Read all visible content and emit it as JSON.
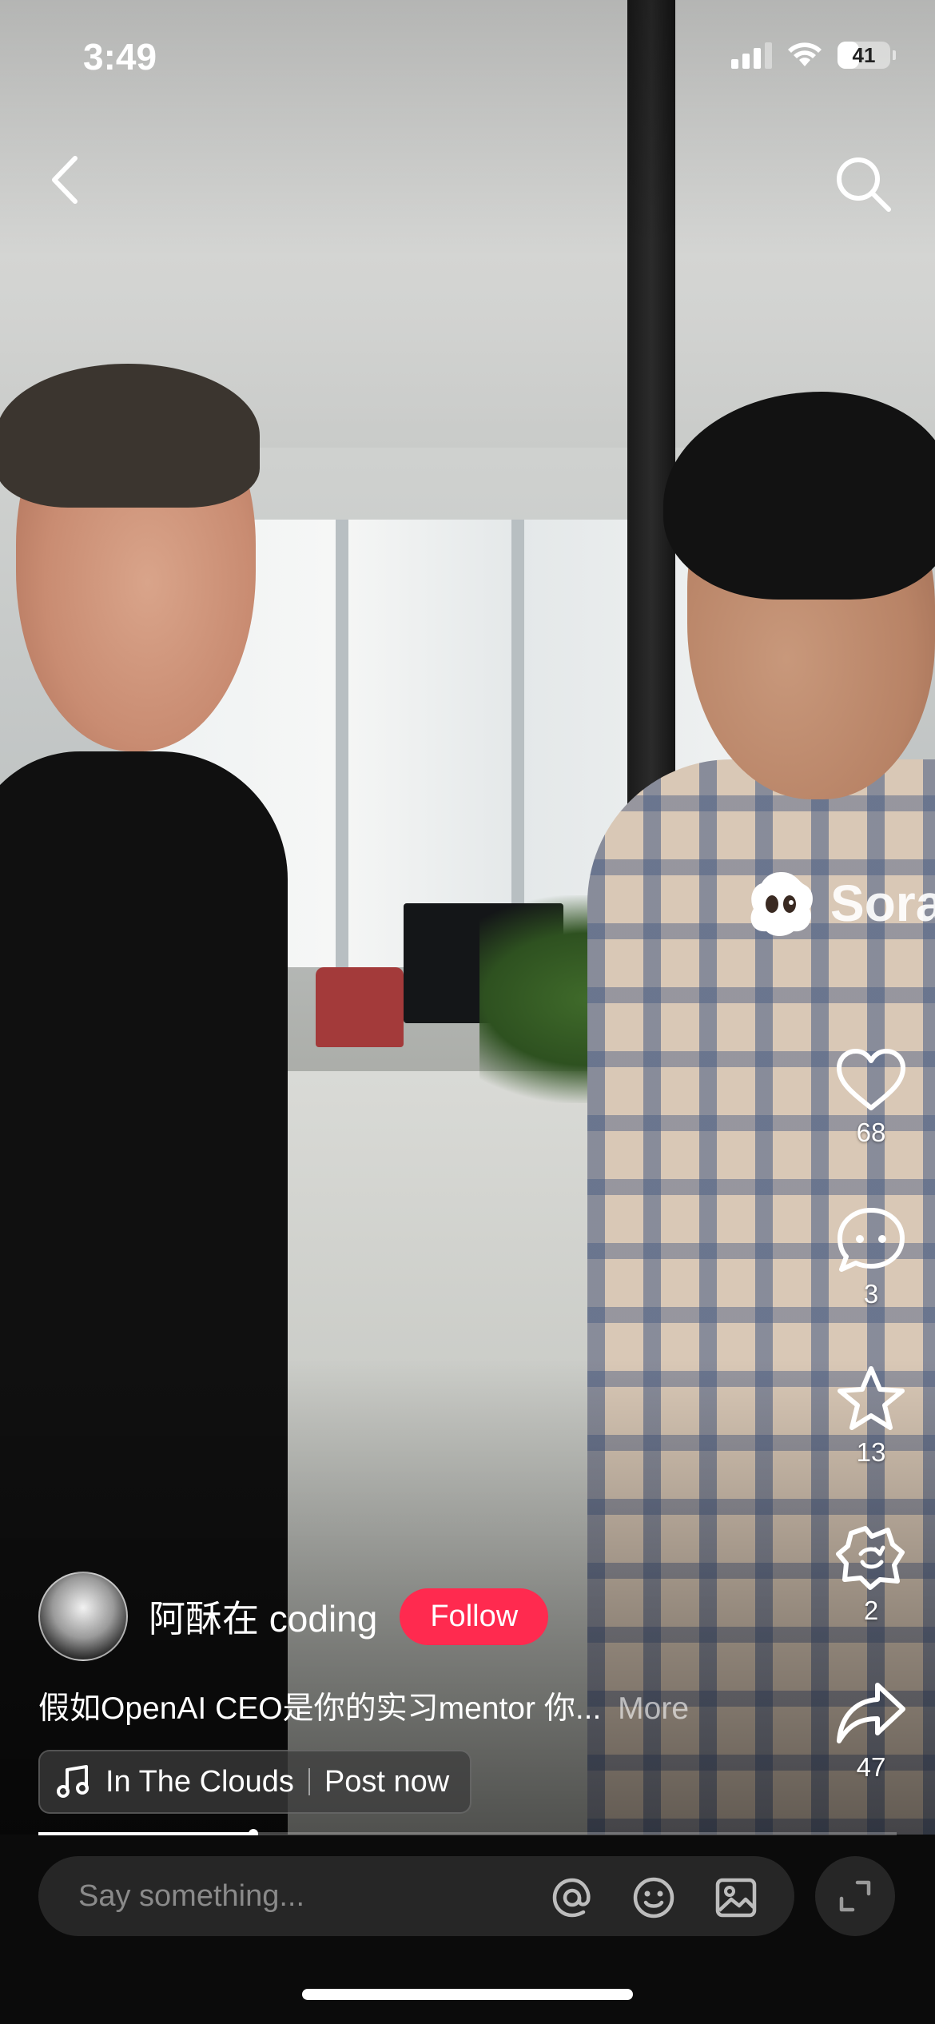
{
  "status_bar": {
    "time": "3:49",
    "battery": "41",
    "battery_level": 0.41
  },
  "nav": {
    "back_icon": "chevron-left-icon",
    "search_icon": "search-icon"
  },
  "watermark": {
    "text": "Sora"
  },
  "actions": {
    "like_count": "68",
    "comment_count": "3",
    "favorite_count": "13",
    "remix_count": "2",
    "share_count": "47"
  },
  "author": {
    "name": "阿酥在 coding",
    "follow_label": "Follow"
  },
  "caption": {
    "text": "假如OpenAI CEO是你的实习mentor 你...",
    "more_label": "More"
  },
  "music": {
    "title": "In The Clouds",
    "post_label": "Post now"
  },
  "playback": {
    "progress": 0.25
  },
  "comment": {
    "placeholder": "Say something..."
  },
  "colors": {
    "follow": "#ff2a4f",
    "bottom_bar": "#0b0b0b",
    "input_bg": "#262626"
  }
}
